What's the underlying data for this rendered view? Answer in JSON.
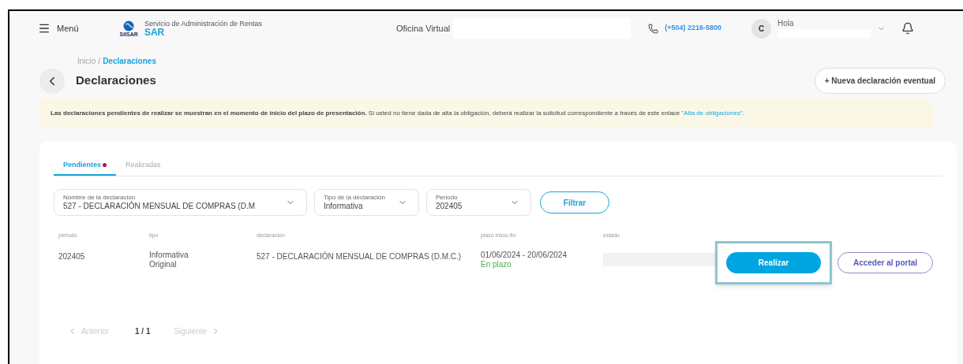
{
  "header": {
    "menu_label": "Menú",
    "logo_text": "SIISAR",
    "org_name": "Servicio de Administración de Rentas",
    "org_short": "SAR",
    "office_label": "Oficina Virtual",
    "phone": "(+504) 2216-5800",
    "avatar_letter": "C",
    "greeting": "Hola"
  },
  "breadcrumb_separator": "/",
  "breadcrumb": [
    {
      "label": "Inicio",
      "selected": false
    },
    {
      "label": "Declaraciones",
      "selected": true
    }
  ],
  "title": "Declaraciones",
  "new_button": "+ Nueva declaración eventual",
  "notice": "**Las declaraciones pendientes de realizar se muestran en el momento de inicio del plazo de presentación.** Si usted no tiene dada de alta la obligación, deberá realizar la solicitud correspondiente a través de este enlace",
  "notice_link": "\"Alta de obligaciones\"",
  "notice_end": ".",
  "tabs": [
    {
      "label": "Pendientes",
      "selected": true,
      "badge": true
    },
    {
      "label": "Realizadas",
      "selected": false,
      "badge": false
    }
  ],
  "filters": [
    {
      "label": "Nombre de la declaración",
      "value": "527 - DECLARACIÓN MENSUAL DE COMPRAS (D.M"
    },
    {
      "label": "Tipo de la declaración",
      "value": "Informativa"
    },
    {
      "label": "Periodo",
      "value": "202405"
    }
  ],
  "filter_button": "Filtrar",
  "table": {
    "columns": [
      "periodo",
      "tipo",
      "declaración",
      "plazo inicio-fin",
      "estado"
    ],
    "rows": [
      {
        "periodo": "202405",
        "tipo": [
          "Informativa",
          "Original"
        ],
        "declaracion": "527 - DECLARACIÓN MENSUAL DE COMPRAS (D.M.C.)",
        "plazo": "01/06/2024 - 20/06/2024",
        "plazo_status": "En plazo",
        "primary_action": "Realizar",
        "highlighted": true,
        "secondary_action": "Acceder al portal"
      }
    ]
  },
  "pagination": {
    "prev": "Anterior",
    "page": "1 / 1",
    "next": "Siguiente"
  }
}
